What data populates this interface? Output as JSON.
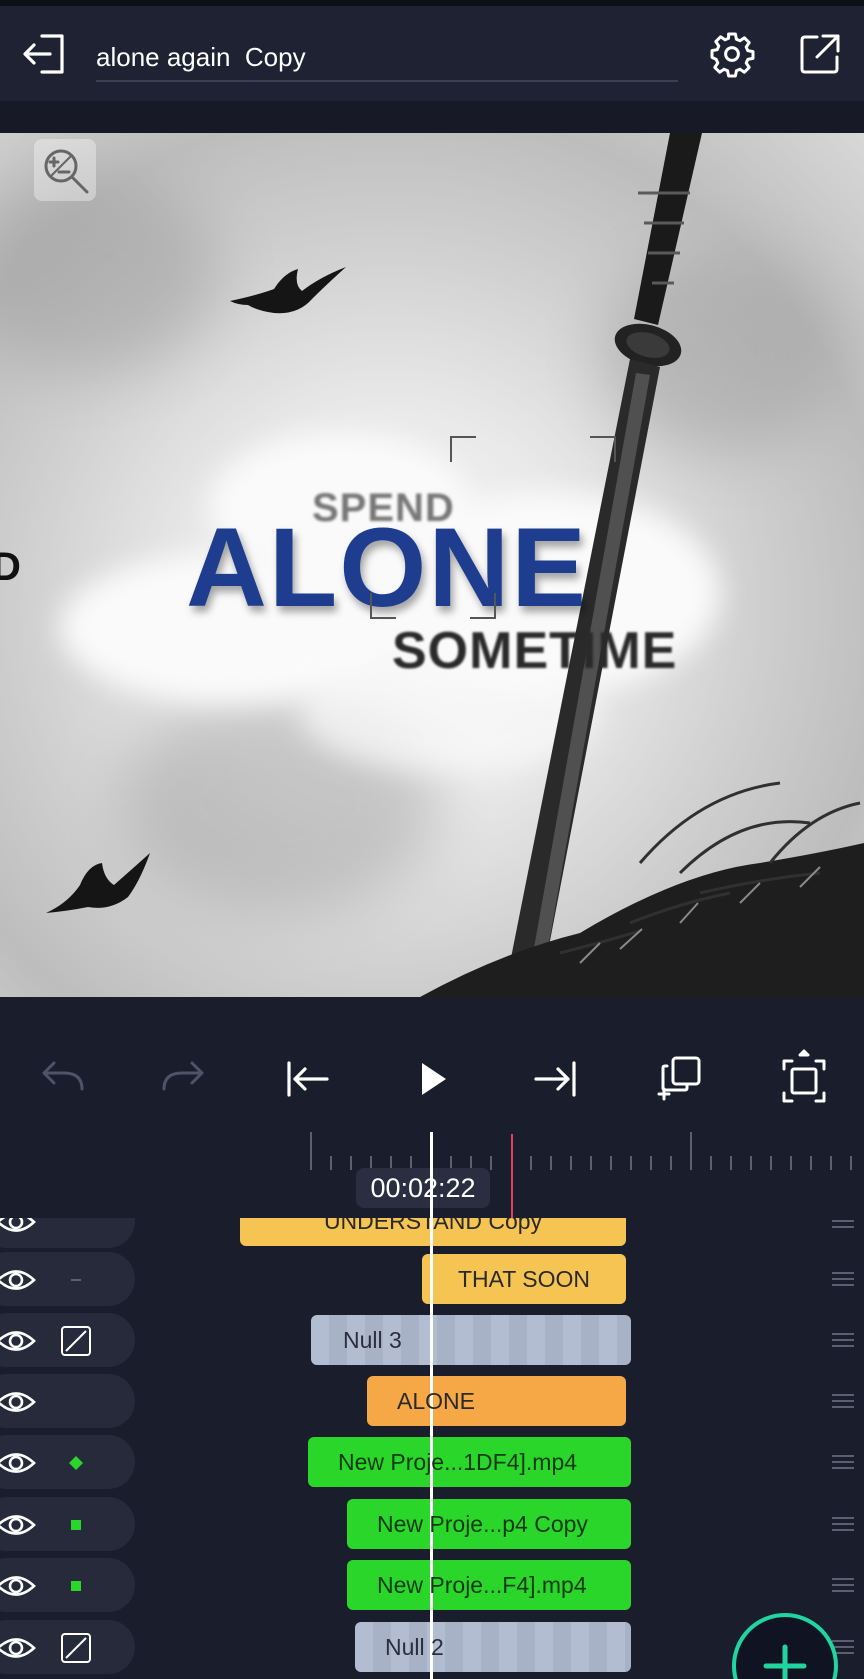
{
  "header": {
    "back_icon": "exit-icon",
    "project_title": "alone again  Copy",
    "settings_icon": "gear-icon",
    "share_icon": "export-icon"
  },
  "preview": {
    "zoom_icon": "zoom-icon",
    "text_spend": "SPEND",
    "text_alone": "ALONE",
    "text_sometime": "SOMETIME",
    "text_edge": "D"
  },
  "transport": {
    "undo_icon": "undo-icon",
    "redo_icon": "redo-icon",
    "jump_start_icon": "jump-start-icon",
    "play_icon": "play-icon",
    "jump_end_icon": "jump-end-icon",
    "copy_icon": "duplicate-icon",
    "fullscreen_icon": "fit-screen-icon"
  },
  "timeline": {
    "timecode": "00:02:22"
  },
  "tracks": [
    {
      "label": "UNDERSTAND Copy",
      "indicator": "none",
      "color": "#f6c453"
    },
    {
      "label": "THAT SOON",
      "indicator": "dash",
      "color": "#f6c453"
    },
    {
      "label": "Null 3",
      "indicator": "null",
      "color": "#b3bdd1"
    },
    {
      "label": "ALONE",
      "indicator": "none",
      "color": "#f5a845"
    },
    {
      "label": "New Proje...1DF4].mp4",
      "indicator": "diamond",
      "color": "#2bd62b"
    },
    {
      "label": "New Proje...p4 Copy",
      "indicator": "square",
      "color": "#2bd62b"
    },
    {
      "label": "New Proje...F4].mp4",
      "indicator": "square",
      "color": "#2bd62b"
    },
    {
      "label": "Null 2",
      "indicator": "null",
      "color": "#b3bdd1"
    }
  ],
  "fab": {
    "icon": "add-icon"
  }
}
